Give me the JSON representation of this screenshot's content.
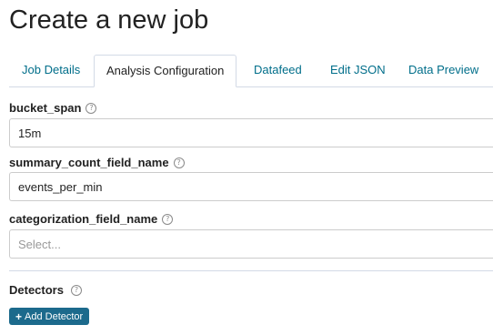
{
  "page": {
    "title": "Create a new job"
  },
  "tabs": [
    {
      "label": "Job Details",
      "active": false
    },
    {
      "label": "Analysis Configuration",
      "active": true
    },
    {
      "label": "Datafeed",
      "active": false
    },
    {
      "label": "Edit JSON",
      "active": false
    },
    {
      "label": "Data Preview",
      "active": false
    }
  ],
  "fields": {
    "bucket_span": {
      "label": "bucket_span",
      "value": "15m",
      "help_icon": "question-circle-icon"
    },
    "summary_count_field_name": {
      "label": "summary_count_field_name",
      "value": "events_per_min",
      "help_icon": "question-circle-icon"
    },
    "categorization_field_name": {
      "label": "categorization_field_name",
      "value": "",
      "placeholder": "Select...",
      "help_icon": "question-circle-icon"
    }
  },
  "detectors": {
    "label": "Detectors",
    "add_button_label": "Add Detector",
    "add_button_icon": "plus-icon"
  },
  "colors": {
    "accent": "#1c6a8c",
    "tab_link": "#006e8a",
    "border": "#cccccc"
  }
}
